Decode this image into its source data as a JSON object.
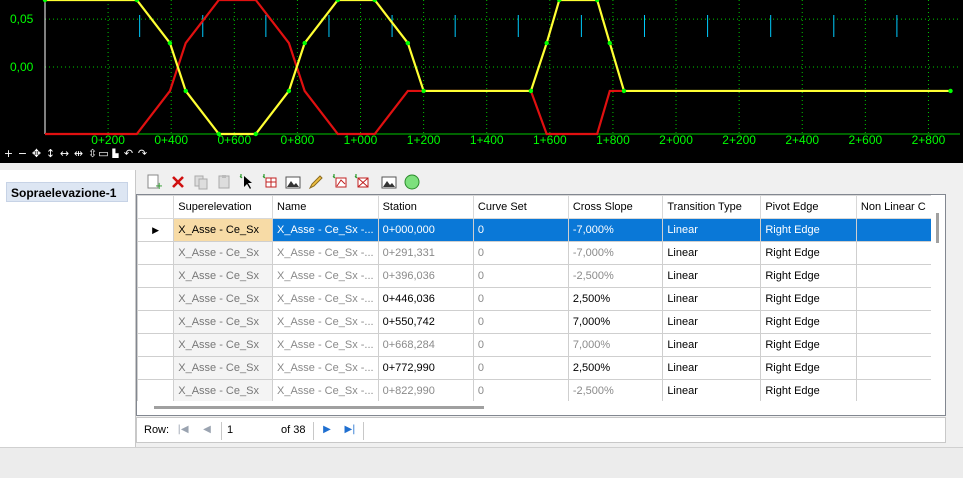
{
  "chart_data": {
    "type": "line",
    "y_ticks": [
      "0,05",
      "0,00"
    ],
    "x_ticks": [
      "0+200",
      "0+400",
      "0+600",
      "0+800",
      "1+000",
      "1+200",
      "1+400",
      "1+600",
      "1+800",
      "2+000",
      "2+200",
      "2+400",
      "2+600",
      "2+800"
    ],
    "xlim": [
      0,
      2900
    ],
    "ylim": [
      -0.07,
      0.07
    ],
    "grid": true,
    "series": [
      {
        "color": "#ffff33",
        "points": [
          [
            0,
            0.07
          ],
          [
            291,
            0.07
          ],
          [
            396,
            0.025
          ],
          [
            446,
            -0.025
          ],
          [
            551,
            -0.07
          ],
          [
            668,
            -0.07
          ],
          [
            773,
            -0.025
          ],
          [
            823,
            0.025
          ],
          [
            928,
            0.07
          ],
          [
            1045,
            0.07
          ],
          [
            1150,
            0.025
          ],
          [
            1200,
            -0.025
          ],
          [
            1540,
            -0.025
          ],
          [
            1590,
            0.025
          ],
          [
            1630,
            0.07
          ],
          [
            1750,
            0.07
          ],
          [
            1790,
            0.025
          ],
          [
            1835,
            -0.025
          ],
          [
            2870,
            -0.025
          ]
        ]
      },
      {
        "color": "#e01010",
        "points": [
          [
            0,
            -0.07
          ],
          [
            291,
            -0.07
          ],
          [
            396,
            -0.025
          ],
          [
            446,
            0.025
          ],
          [
            551,
            0.07
          ],
          [
            668,
            0.07
          ],
          [
            773,
            0.025
          ],
          [
            823,
            -0.025
          ],
          [
            928,
            -0.07
          ],
          [
            1045,
            -0.07
          ],
          [
            1150,
            -0.025
          ],
          [
            1200,
            -0.025
          ],
          [
            1540,
            -0.025
          ],
          [
            1590,
            -0.07
          ],
          [
            1750,
            -0.07
          ],
          [
            1790,
            -0.025
          ],
          [
            1835,
            -0.025
          ]
        ]
      }
    ]
  },
  "colors": {
    "grid_line": "#00c800",
    "tick_label": "#00ff00",
    "axis": "#ffffff",
    "marker": "#00ff00",
    "blue_tick": "#00ccff",
    "selected_row": "#0a78d7",
    "selected_cell": "#f7dba6"
  },
  "tree": {
    "item": "Sopraelevazione-1"
  },
  "toolbar_icons": [
    "new-row-icon",
    "delete-icon",
    "copy-icon",
    "paste-icon",
    "pick-icon",
    "table-view-icon",
    "picture-icon",
    "pencil-icon",
    "add-graph-icon",
    "remove-graph-icon",
    "image-icon",
    "green-circle-icon"
  ],
  "grid": {
    "columns": [
      "Superelevation",
      "Name",
      "Station",
      "Curve Set",
      "Cross Slope",
      "Transition Type",
      "Pivot Edge",
      "Non Linear C"
    ],
    "rows": [
      {
        "sup": "X_Asse - Ce_Sx",
        "name": "X_Asse - Ce_Sx -...",
        "station": "0+000,000",
        "curve_set": "0",
        "cross_slope": "-7,000%",
        "transition": "Linear",
        "pivot": "Right Edge",
        "grey": false
      },
      {
        "sup": "X_Asse - Ce_Sx",
        "name": "X_Asse - Ce_Sx -...",
        "station": "0+291,331",
        "curve_set": "0",
        "cross_slope": "-7,000%",
        "transition": "Linear",
        "pivot": "Right Edge",
        "grey": true
      },
      {
        "sup": "X_Asse - Ce_Sx",
        "name": "X_Asse - Ce_Sx -...",
        "station": "0+396,036",
        "curve_set": "0",
        "cross_slope": "-2,500%",
        "transition": "Linear",
        "pivot": "Right Edge",
        "grey": true
      },
      {
        "sup": "X_Asse - Ce_Sx",
        "name": "X_Asse - Ce_Sx -...",
        "station": "0+446,036",
        "curve_set": "0",
        "cross_slope": "2,500%",
        "transition": "Linear",
        "pivot": "Right Edge",
        "grey": false
      },
      {
        "sup": "X_Asse - Ce_Sx",
        "name": "X_Asse - Ce_Sx -...",
        "station": "0+550,742",
        "curve_set": "0",
        "cross_slope": "7,000%",
        "transition": "Linear",
        "pivot": "Right Edge",
        "grey": false
      },
      {
        "sup": "X_Asse - Ce_Sx",
        "name": "X_Asse - Ce_Sx -...",
        "station": "0+668,284",
        "curve_set": "0",
        "cross_slope": "7,000%",
        "transition": "Linear",
        "pivot": "Right Edge",
        "grey": true
      },
      {
        "sup": "X_Asse - Ce_Sx",
        "name": "X_Asse - Ce_Sx -...",
        "station": "0+772,990",
        "curve_set": "0",
        "cross_slope": "2,500%",
        "transition": "Linear",
        "pivot": "Right Edge",
        "grey": false
      },
      {
        "sup": "X_Asse - Ce_Sx",
        "name": "X_Asse - Ce_Sx -...",
        "station": "0+822,990",
        "curve_set": "0",
        "cross_slope": "-2,500%",
        "transition": "Linear",
        "pivot": "Right Edge",
        "grey": true
      }
    ],
    "selected_index": 0
  },
  "navigator": {
    "label": "Row:",
    "current": "1",
    "of_text": "of 38"
  }
}
